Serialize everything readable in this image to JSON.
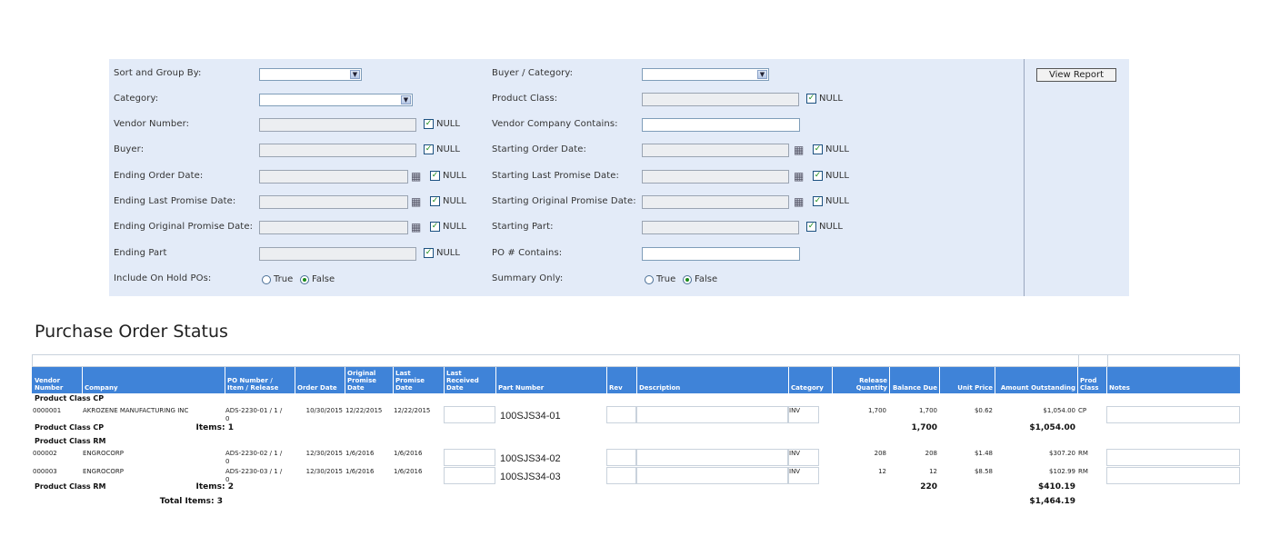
{
  "params": {
    "left": [
      {
        "label": "Sort and Group By:",
        "type": "select"
      },
      {
        "label": "Category:",
        "type": "select"
      },
      {
        "label": "Vendor Number:",
        "type": "input-null"
      },
      {
        "label": "Buyer:",
        "type": "input-null"
      },
      {
        "label": "Ending Order Date:",
        "type": "date-null"
      },
      {
        "label": "Ending Last Promise Date:",
        "type": "date-null"
      },
      {
        "label": "Ending Original Promise Date:",
        "type": "date-null"
      },
      {
        "label": "Ending Part",
        "type": "input-null"
      },
      {
        "label": "Include On Hold POs:",
        "type": "radio"
      }
    ],
    "right": [
      {
        "label": "Buyer / Category:",
        "type": "select"
      },
      {
        "label": "Product Class:",
        "type": "input-null"
      },
      {
        "label": "Vendor Company Contains:",
        "type": "text"
      },
      {
        "label": "Starting Order Date:",
        "type": "date-null"
      },
      {
        "label": "Starting Last Promise Date:",
        "type": "date-null"
      },
      {
        "label": "Starting Original Promise Date:",
        "type": "date-null"
      },
      {
        "label": "Starting Part:",
        "type": "input-null"
      },
      {
        "label": "PO # Contains:",
        "type": "text"
      },
      {
        "label": "Summary Only:",
        "type": "radio"
      }
    ],
    "null_label": "NULL",
    "radio_true": "True",
    "radio_false": "False",
    "radio_selected": "False",
    "view_report": "View Report"
  },
  "report": {
    "title": "Purchase Order Status",
    "columns": [
      "Vendor\nNumber",
      "Company",
      "PO Number /\nItem / Release",
      "Order Date",
      "Original\nPromise\nDate",
      "Last\nPromise\nDate",
      "Last\nReceived\nDate",
      "Part Number",
      "Rev",
      "Description",
      "Category",
      "Release\nQuantity",
      "Balance Due",
      "Unit Price",
      "Amount Outstanding",
      "Prod\nClass",
      "Notes"
    ],
    "groups": [
      {
        "label": "Product Class  CP",
        "rows": [
          {
            "vendor": "0000001",
            "company": "AKROZENE MANUFACTURING INC",
            "po": "ADS-2230-01 /   1 /",
            "po_tail": "0",
            "order_date": "10/30/2015",
            "orig_promise": "12/22/2015",
            "last_promise": "12/22/2015",
            "part": "100SJS34-01",
            "category": "INV",
            "release_qty": "1,700",
            "balance_due": "1,700",
            "unit_price": "$0.62",
            "amount": "$1,054.00",
            "prod_class": "CP"
          }
        ],
        "footer_label": "Product Class  CP",
        "items_label": "Items: 1",
        "balance_total": "1,700",
        "amount_total": "$1,054.00"
      },
      {
        "label": "Product Class  RM",
        "rows": [
          {
            "vendor": "000002",
            "company": "ENGROCORP",
            "po": "ADS-2230-02 /   1 /",
            "po_tail": "0",
            "order_date": "12/30/2015",
            "orig_promise": "1/6/2016",
            "last_promise": "1/6/2016",
            "part": "100SJS34-02",
            "category": "INV",
            "release_qty": "208",
            "balance_due": "208",
            "unit_price": "$1.48",
            "amount": "$307.20",
            "prod_class": "RM"
          },
          {
            "vendor": "000003",
            "company": "ENGROCORP",
            "po": "ADS-2230-03 /   1 /",
            "po_tail": "0",
            "order_date": "12/30/2015",
            "orig_promise": "1/6/2016",
            "last_promise": "1/6/2016",
            "part": "100SJS34-03",
            "category": "INV",
            "release_qty": "12",
            "balance_due": "12",
            "unit_price": "$8.58",
            "amount": "$102.99",
            "prod_class": "RM"
          }
        ],
        "footer_label": "Product Class  RM",
        "items_label": "Items: 2",
        "balance_total": "220",
        "amount_total": "$410.19"
      }
    ],
    "total_items_label": "Total Items: 3",
    "grand_total": "$1,464.19"
  }
}
